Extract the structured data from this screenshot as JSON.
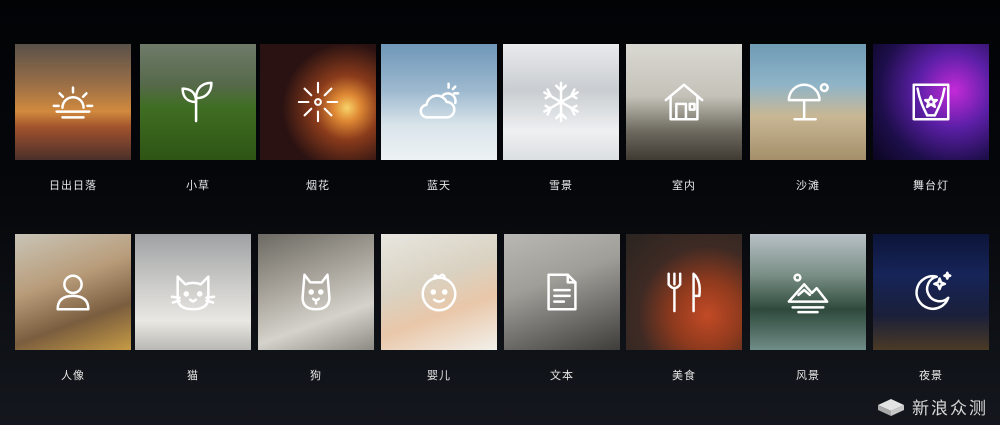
{
  "scenes": [
    {
      "label": "日出日落",
      "icon": "sunrise-icon"
    },
    {
      "label": "小草",
      "icon": "sprout-icon"
    },
    {
      "label": "烟花",
      "icon": "fireworks-icon"
    },
    {
      "label": "蓝天",
      "icon": "partly-cloudy-icon"
    },
    {
      "label": "雪景",
      "icon": "snowflake-icon"
    },
    {
      "label": "室内",
      "icon": "house-icon"
    },
    {
      "label": "沙滩",
      "icon": "beach-umbrella-icon"
    },
    {
      "label": "舞台灯",
      "icon": "stage-icon"
    },
    {
      "label": "人像",
      "icon": "person-icon"
    },
    {
      "label": "猫",
      "icon": "cat-icon"
    },
    {
      "label": "狗",
      "icon": "dog-icon"
    },
    {
      "label": "婴儿",
      "icon": "baby-icon"
    },
    {
      "label": "文本",
      "icon": "document-icon"
    },
    {
      "label": "美食",
      "icon": "fork-knife-icon"
    },
    {
      "label": "风景",
      "icon": "mountain-icon"
    },
    {
      "label": "夜景",
      "icon": "moon-stars-icon"
    }
  ],
  "watermark": {
    "text": "新浪众测",
    "icon": "sina-logo-icon"
  }
}
